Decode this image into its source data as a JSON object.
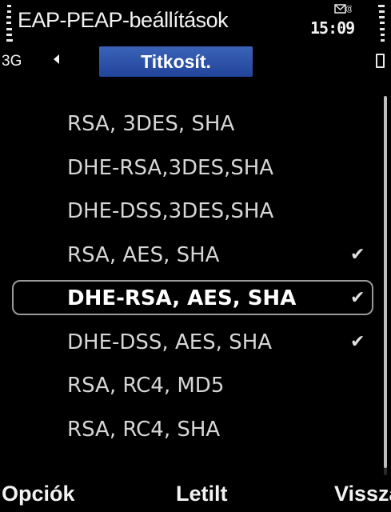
{
  "status_bar": {
    "title": "EAP-PEAP-beállítások",
    "time": "15:09",
    "network": "3G",
    "icons": [
      "signal-strength-icon",
      "message-icon",
      "battery-level-icon",
      "battery-icon",
      "nav-left-arrow-icon"
    ]
  },
  "tab": {
    "label": "Titkosít."
  },
  "cipher_list": {
    "items": [
      {
        "label": "RSA, 3DES, SHA",
        "checked": false,
        "check_mark": ""
      },
      {
        "label": "DHE-RSA,3DES,SHA",
        "checked": false,
        "check_mark": ""
      },
      {
        "label": "DHE-DSS,3DES,SHA",
        "checked": false,
        "check_mark": ""
      },
      {
        "label": "RSA, AES, SHA",
        "checked": true,
        "check_mark": "✔"
      },
      {
        "label": "DHE-RSA, AES, SHA",
        "checked": true,
        "check_mark": "✔",
        "selected": true
      },
      {
        "label": "DHE-DSS, AES, SHA",
        "checked": true,
        "check_mark": "✔"
      },
      {
        "label": "RSA, RC4, MD5",
        "checked": false,
        "check_mark": ""
      },
      {
        "label": "RSA, RC4, SHA",
        "checked": false,
        "check_mark": ""
      }
    ],
    "scroll_fraction": 0.98
  },
  "softkeys": {
    "left": "Opciók",
    "middle": "Letilt",
    "right": "Vissza"
  },
  "colors": {
    "background": "#000000",
    "tab_background": "#2d55a8",
    "text": "#d6d6d6",
    "selection_border": "#9a9a9a"
  }
}
